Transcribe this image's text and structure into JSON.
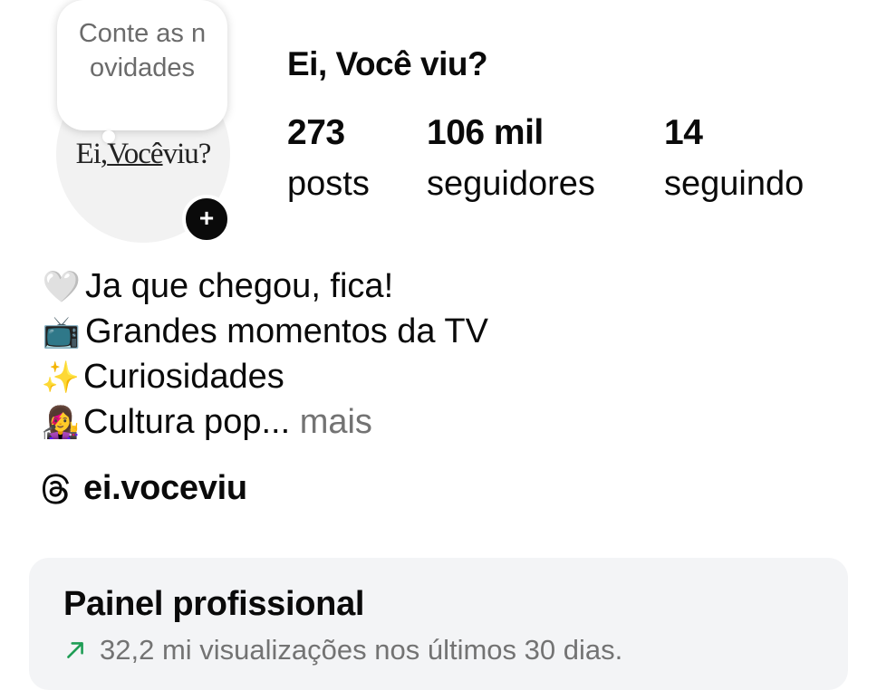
{
  "note": {
    "text": "Conte as novidades"
  },
  "avatar": {
    "logo_part1": "Ei,",
    "logo_part2": "Você",
    "logo_part3": "viu?"
  },
  "add_story": {
    "icon_glyph": "+"
  },
  "profile": {
    "name": "Ei, Você viu?"
  },
  "stats": [
    {
      "value": "273",
      "label": "posts"
    },
    {
      "value": "106 mil",
      "label": "seguidores"
    },
    {
      "value": "14",
      "label": "seguindo"
    }
  ],
  "bio": {
    "lines": [
      {
        "emoji": "🤍",
        "text": "Ja que chegou, fica!"
      },
      {
        "emoji": "📺",
        "text": "Grandes momentos da TV"
      },
      {
        "emoji": "✨",
        "text": "Curiosidades"
      },
      {
        "emoji": "👩‍🎤",
        "text": "Cultura pop..."
      }
    ],
    "more_label": "mais"
  },
  "threads": {
    "handle": "ei.voceviu"
  },
  "dashboard": {
    "title": "Painel profissional",
    "subtitle": "32,2 mi visualizações nos últimos 30 dias."
  },
  "colors": {
    "text_primary": "#0a0a0a",
    "text_secondary": "#737373",
    "trend_green": "#1f9d55",
    "card_bg": "#f3f4f6"
  },
  "icons": {
    "threads": "threads-icon",
    "trend": "arrow-up-right-icon",
    "add": "plus-icon"
  }
}
